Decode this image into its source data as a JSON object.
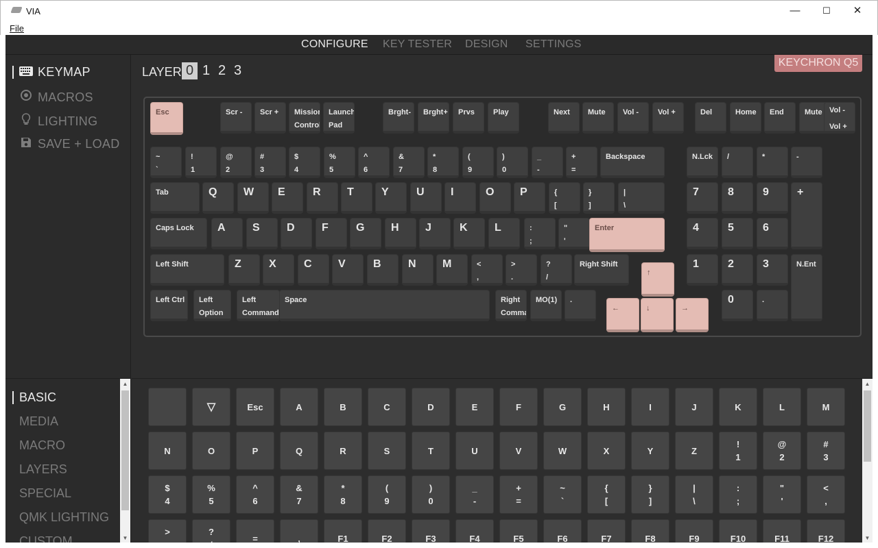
{
  "window": {
    "title": "VIA",
    "minimize": "—",
    "maximize": "☐",
    "close": "✕",
    "menu_file": "File"
  },
  "nav": {
    "tabs": [
      "CONFIGURE",
      "KEY TESTER",
      "DESIGN",
      "SETTINGS"
    ],
    "active": "CONFIGURE"
  },
  "sidebar": {
    "items": [
      {
        "label": "KEYMAP",
        "icon": "keyboard-icon",
        "active": true
      },
      {
        "label": "MACROS",
        "icon": "macro-circle-icon",
        "active": false
      },
      {
        "label": "LIGHTING",
        "icon": "lightbulb-icon",
        "active": false
      },
      {
        "label": "SAVE + LOAD",
        "icon": "floppy-disk-icon",
        "active": false
      }
    ]
  },
  "layers": {
    "label": "LAYER",
    "numbers": [
      "0",
      "1",
      "2",
      "3"
    ],
    "selected": "0"
  },
  "device": {
    "name": "KEYCHRON Q5"
  },
  "keyboard": {
    "keys": [
      {
        "l": "Esc",
        "hl": true
      },
      {
        "l": "Scr -"
      },
      {
        "l": "Scr +"
      },
      {
        "l": "Mission\nControl"
      },
      {
        "l": "Launch\nPad"
      },
      {
        "l": "Brght-"
      },
      {
        "l": "Brght+"
      },
      {
        "l": "Prvs"
      },
      {
        "l": "Play"
      },
      {
        "l": "Next"
      },
      {
        "l": "Mute"
      },
      {
        "l": "Vol -"
      },
      {
        "l": "Vol +"
      },
      {
        "l": "Del"
      },
      {
        "l": "Home"
      },
      {
        "l": "End"
      },
      {
        "l": "Mute"
      },
      {
        "l": "Vol -\n\nVol +"
      },
      {
        "l": "~\n`"
      },
      {
        "l": "!\n1"
      },
      {
        "l": "@\n2"
      },
      {
        "l": "#\n3"
      },
      {
        "l": "$\n4"
      },
      {
        "l": "%\n5"
      },
      {
        "l": "^\n6"
      },
      {
        "l": "&\n7"
      },
      {
        "l": "*\n8"
      },
      {
        "l": "(\n9"
      },
      {
        "l": ")\n0"
      },
      {
        "l": "_\n-"
      },
      {
        "l": "+\n="
      },
      {
        "l": "Backspace"
      },
      {
        "l": "N.Lck"
      },
      {
        "l": "/"
      },
      {
        "l": "*"
      },
      {
        "l": "-"
      },
      {
        "l": "Tab"
      },
      {
        "l": "Q"
      },
      {
        "l": "W"
      },
      {
        "l": "E"
      },
      {
        "l": "R"
      },
      {
        "l": "T"
      },
      {
        "l": "Y"
      },
      {
        "l": "U"
      },
      {
        "l": "I"
      },
      {
        "l": "O"
      },
      {
        "l": "P"
      },
      {
        "l": "{\n["
      },
      {
        "l": "}\n]"
      },
      {
        "l": "|\n\\"
      },
      {
        "l": "7"
      },
      {
        "l": "8"
      },
      {
        "l": "9"
      },
      {
        "l": "+"
      },
      {
        "l": "Caps Lock"
      },
      {
        "l": "A"
      },
      {
        "l": "S"
      },
      {
        "l": "D"
      },
      {
        "l": "F"
      },
      {
        "l": "G"
      },
      {
        "l": "H"
      },
      {
        "l": "J"
      },
      {
        "l": "K"
      },
      {
        "l": "L"
      },
      {
        "l": ":\n;"
      },
      {
        "l": "\"\n'"
      },
      {
        "l": "Enter",
        "hl": true
      },
      {
        "l": "4"
      },
      {
        "l": "5"
      },
      {
        "l": "6"
      },
      {
        "l": "Left Shift"
      },
      {
        "l": "Z"
      },
      {
        "l": "X"
      },
      {
        "l": "C"
      },
      {
        "l": "V"
      },
      {
        "l": "B"
      },
      {
        "l": "N"
      },
      {
        "l": "M"
      },
      {
        "l": "<\n,"
      },
      {
        "l": ">\n."
      },
      {
        "l": "?\n/"
      },
      {
        "l": "Right Shift"
      },
      {
        "l": "↑",
        "hl": true
      },
      {
        "l": "1"
      },
      {
        "l": "2"
      },
      {
        "l": "3"
      },
      {
        "l": "N.Ent"
      },
      {
        "l": "Left Ctrl"
      },
      {
        "l": "Left\nOption"
      },
      {
        "l": "Left\nCommand"
      },
      {
        "l": "Space"
      },
      {
        "l": "Right\nCommand"
      },
      {
        "l": "MO(1)"
      },
      {
        "l": "."
      },
      {
        "l": "←",
        "hl": true
      },
      {
        "l": "↓",
        "hl": true
      },
      {
        "l": "→",
        "hl": true
      },
      {
        "l": "0"
      },
      {
        "l": "."
      }
    ]
  },
  "categories": {
    "items": [
      "BASIC",
      "MEDIA",
      "MACRO",
      "LAYERS",
      "SPECIAL",
      "QMK LIGHTING",
      "CUSTOM"
    ],
    "active": "BASIC"
  },
  "palette": {
    "keys": [
      "",
      "▽",
      "Esc",
      "A",
      "B",
      "C",
      "D",
      "E",
      "F",
      "G",
      "H",
      "I",
      "J",
      "K",
      "L",
      "M",
      "N",
      "O",
      "P",
      "Q",
      "R",
      "S",
      "T",
      "U",
      "V",
      "W",
      "X",
      "Y",
      "Z",
      "!\n1",
      "@\n2",
      "#\n3",
      "$\n4",
      "%\n5",
      "^\n6",
      "&\n7",
      "*\n8",
      "(\n9",
      ")\n0",
      "_\n-",
      "+\n=",
      "~\n`",
      "{\n[",
      "}\n]",
      "|\n\\",
      ":\n;",
      "\"\n'",
      "<\n,",
      ">\n.",
      "?\n/",
      "=",
      ",",
      "F1",
      "F2",
      "F3",
      "F4",
      "F5",
      "F6",
      "F7",
      "F8",
      "F9",
      "F10",
      "F11",
      "F12"
    ]
  },
  "colors": {
    "accent": "#c47e7f",
    "highlight_key": "#e4bcb4",
    "key": "#3f3f3f",
    "background": "#2d2d2d"
  }
}
